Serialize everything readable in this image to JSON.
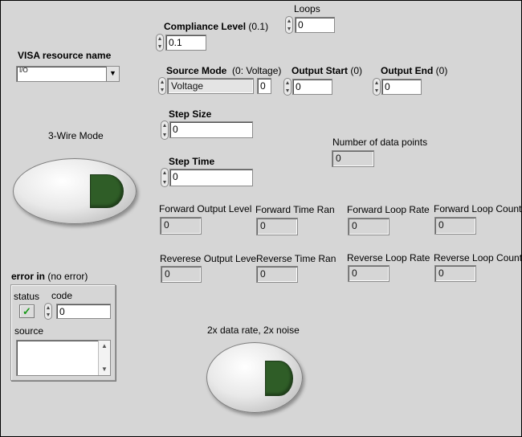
{
  "loops": {
    "label": "Loops",
    "value": "0"
  },
  "compliance": {
    "label": "Compliance Level",
    "hint": "(0.1)",
    "value": "0.1"
  },
  "visa": {
    "label": "VISA resource name",
    "icon_text": "I/O",
    "value": ""
  },
  "source_mode": {
    "label": "Source Mode",
    "hint": "(0: Voltage)",
    "value": "Voltage",
    "index": "0"
  },
  "output_start": {
    "label": "Output Start",
    "hint": "(0)",
    "value": "0"
  },
  "output_end": {
    "label": "Output End",
    "hint": "(0)",
    "value": "0"
  },
  "step_size": {
    "label": "Step Size",
    "value": "0"
  },
  "step_time": {
    "label": "Step Time",
    "value": "0"
  },
  "num_points": {
    "label": "Number of data points",
    "value": "0"
  },
  "three_wire": {
    "label": "3-Wire Mode"
  },
  "two_x": {
    "label": "2x data rate, 2x noise"
  },
  "indicators": [
    {
      "label": "Forward Output Level",
      "value": "0"
    },
    {
      "label": "Forward Time Ran",
      "value": "0"
    },
    {
      "label": "Forward Loop Rate",
      "value": "0"
    },
    {
      "label": "Forward Loop Count",
      "value": "0"
    },
    {
      "label": "Reverese Output Level",
      "value": "0"
    },
    {
      "label": "Reverse Time Ran",
      "value": "0"
    },
    {
      "label": "Reverse Loop Rate",
      "value": "0"
    },
    {
      "label": "Reverse Loop Count",
      "value": "0"
    }
  ],
  "error_in": {
    "label": "error in",
    "hint": "(no error)",
    "status_label": "status",
    "code_label": "code",
    "code_value": "0",
    "source_label": "source",
    "source_value": "",
    "check_glyph": "✓"
  },
  "colors": {
    "panel_bg": "#d6d6d6",
    "led_green": "#2f5d27"
  },
  "icons": {
    "spinner": "up-down-arrows",
    "dropdown": "down-arrow",
    "scroll_up": "up-arrow",
    "scroll_down": "down-arrow"
  }
}
